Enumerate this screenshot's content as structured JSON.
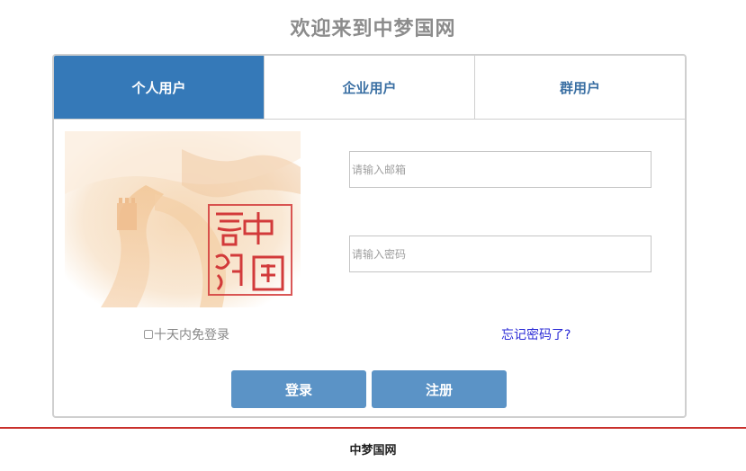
{
  "page": {
    "title": "欢迎来到中梦国网"
  },
  "tabs": [
    {
      "label": "个人用户",
      "active": true
    },
    {
      "label": "企业用户",
      "active": false
    },
    {
      "label": "群用户",
      "active": false
    }
  ],
  "emblem": {
    "seal_text": "中國夢網",
    "icon": "great-wall-seal-image"
  },
  "form": {
    "email_placeholder": "请输入邮箱",
    "password_placeholder": "请输入密码",
    "remember_label": "十天内免登录",
    "forgot_label": "忘记密码了?",
    "login_label": "登录",
    "register_label": "注册"
  },
  "footer": {
    "text": "中梦国网"
  },
  "colors": {
    "active_tab": "#3579b8",
    "tab_text": "#3a6fa3",
    "button": "#5b93c6",
    "footer_rule": "#c9302c",
    "link": "#2a2ad6"
  }
}
